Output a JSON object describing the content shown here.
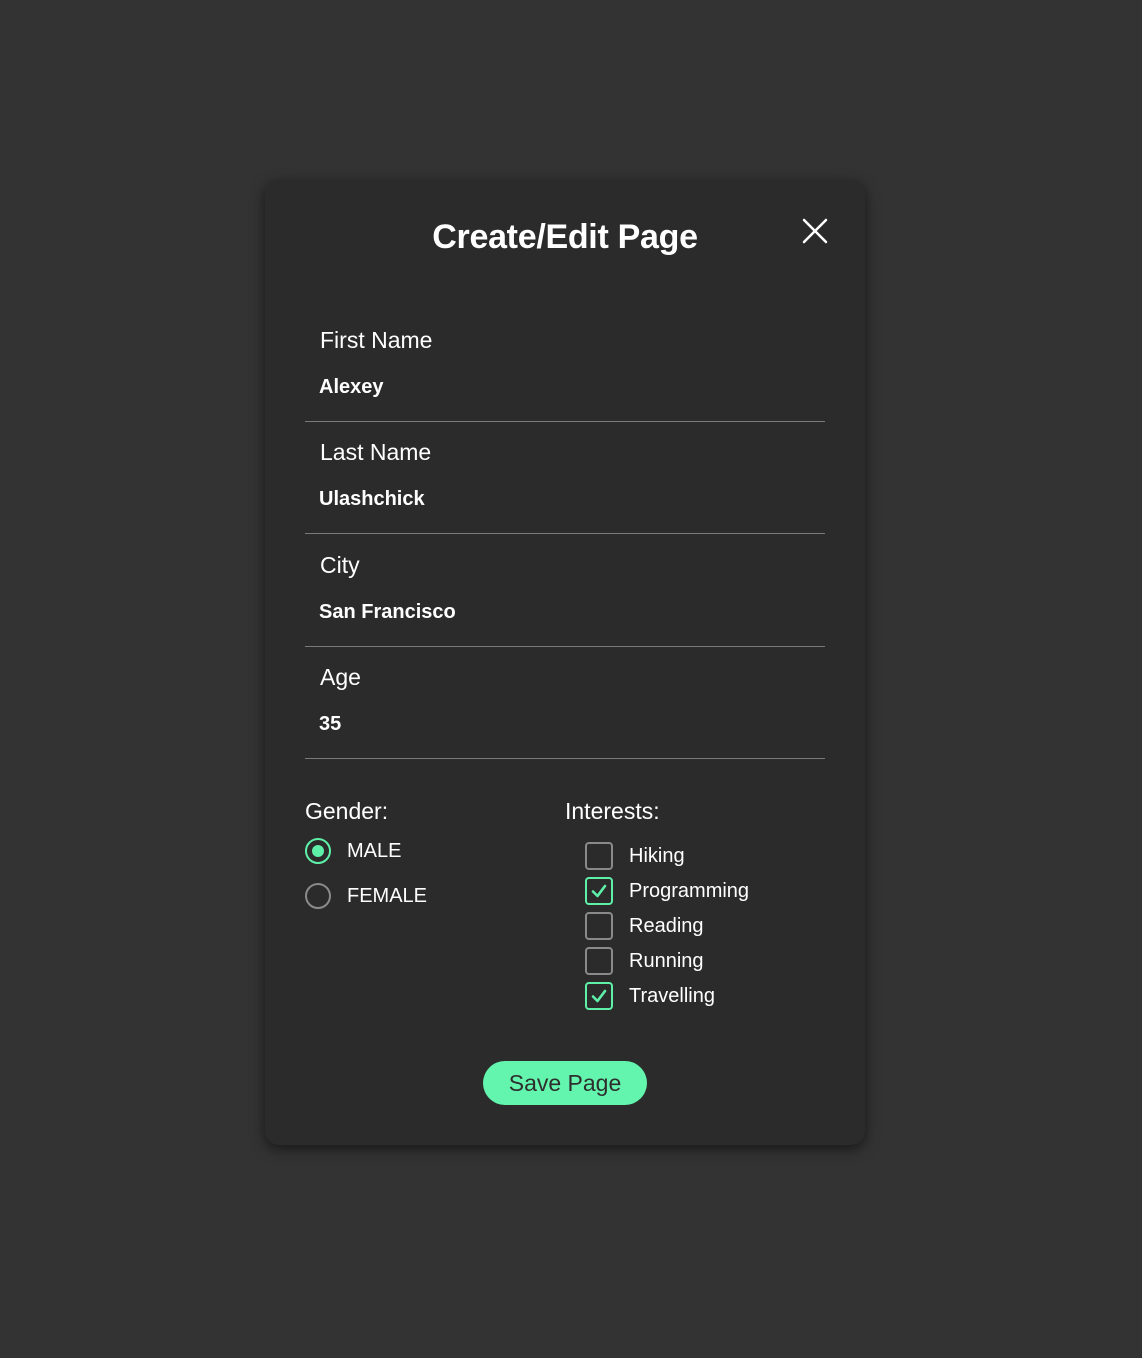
{
  "modal": {
    "title": "Create/Edit Page",
    "close_icon": "close-icon"
  },
  "fields": {
    "first_name": {
      "label": "First Name",
      "value": "Alexey"
    },
    "last_name": {
      "label": "Last Name",
      "value": "Ulashchick"
    },
    "city": {
      "label": "City",
      "value": "San Francisco"
    },
    "age": {
      "label": "Age",
      "value": "35"
    }
  },
  "gender": {
    "label": "Gender:",
    "options": [
      {
        "label": "MALE",
        "selected": true
      },
      {
        "label": "FEMALE",
        "selected": false
      }
    ]
  },
  "interests": {
    "label": "Interests:",
    "options": [
      {
        "label": "Hiking",
        "checked": false
      },
      {
        "label": "Programming",
        "checked": true
      },
      {
        "label": "Reading",
        "checked": false
      },
      {
        "label": "Running",
        "checked": false
      },
      {
        "label": "Travelling",
        "checked": true
      }
    ]
  },
  "actions": {
    "save_label": "Save Page"
  },
  "colors": {
    "background": "#333333",
    "modal": "#2b2b2b",
    "accent": "#5ef0a8",
    "button": "#63f5ad"
  }
}
